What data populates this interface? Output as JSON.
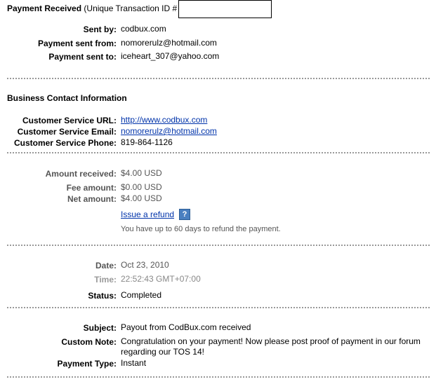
{
  "header": {
    "title": "Payment Received",
    "subtitle": "(Unique Transaction ID #"
  },
  "payment": {
    "sent_by_label": "Sent by:",
    "sent_by": "codbux.com",
    "sent_from_label": "Payment sent from:",
    "sent_from": "nomorerulz@hotmail.com",
    "sent_to_label": "Payment sent to:",
    "sent_to": "iceheart_307@yahoo.com"
  },
  "business": {
    "heading": "Business Contact Information",
    "url_label": "Customer Service URL:",
    "url": "http://www.codbux.com",
    "email_label": "Customer Service Email:",
    "email": "nomorerulz@hotmail.com",
    "phone_label": "Customer Service Phone:",
    "phone": "819-864-1126"
  },
  "amounts": {
    "received_label": "Amount received:",
    "received": "$4.00 USD",
    "fee_label": "Fee amount:",
    "fee": "$0.00 USD",
    "net_label": "Net amount:",
    "net": "$4.00 USD",
    "refund_link": "Issue a refund",
    "help_icon": "question-mark-icon",
    "refund_note": "You have up to 60 days to refund the payment."
  },
  "timing": {
    "date_label": "Date:",
    "date": "Oct 23, 2010",
    "time_label": "Time:",
    "time": "22:52:43 GMT+07:00",
    "status_label": "Status:",
    "status": "Completed"
  },
  "details": {
    "subject_label": "Subject:",
    "subject": "Payout from CodBux.com received",
    "note_label": "Custom Note:",
    "note_line1": "Congratulation on your payment! Now please post proof of payment in our forum",
    "note_line2": "regarding our TOS 14!",
    "type_label": "Payment Type:",
    "type": "Instant"
  }
}
